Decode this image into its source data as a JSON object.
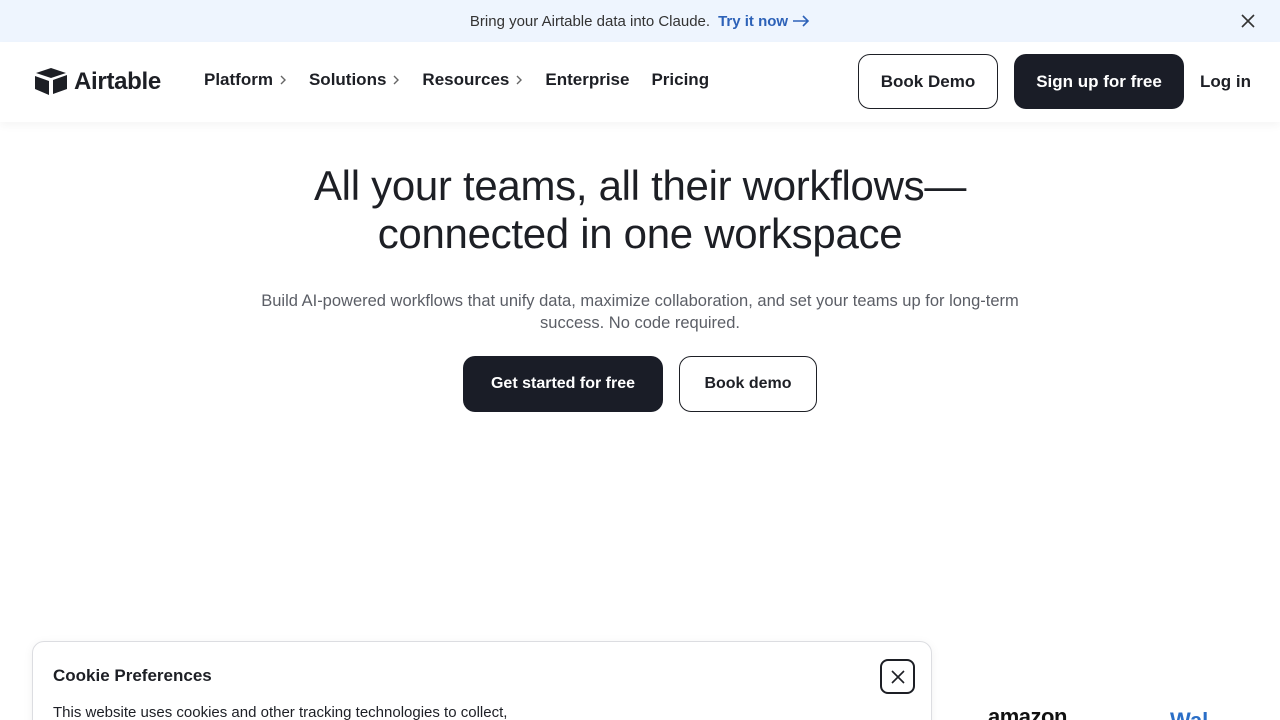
{
  "banner": {
    "message": "Bring your Airtable data into Claude.",
    "link_label": "Try it now",
    "link_icon": "arrow-right-icon",
    "close_icon": "close-icon"
  },
  "header": {
    "logo_text": "Airtable",
    "nav": [
      {
        "label": "Platform",
        "has_chevron": true
      },
      {
        "label": "Solutions",
        "has_chevron": true
      },
      {
        "label": "Resources",
        "has_chevron": true
      },
      {
        "label": "Enterprise",
        "has_chevron": false
      },
      {
        "label": "Pricing",
        "has_chevron": false
      }
    ],
    "book_demo_label": "Book Demo",
    "signup_label": "Sign up for free",
    "login_label": "Log in"
  },
  "hero": {
    "title_line1": "All your teams, all their workflows—",
    "title_line2": "connected in one workspace",
    "subtitle_line1": "Build AI-powered workflows that unify data, maximize collaboration, and set your teams up for long-term",
    "subtitle_line2": "success. No code required.",
    "primary_cta": "Get started for free",
    "secondary_cta": "Book demo"
  },
  "logos": {
    "amazon": "amazon",
    "walmart": "Wal"
  },
  "cookie": {
    "title": "Cookie Preferences",
    "text": "This website uses cookies and other tracking technologies to collect,",
    "close_icon": "close-icon"
  },
  "colors": {
    "banner_bg": "#eef5fe",
    "link_blue": "#2d62b8",
    "dark_button": "#1a1d27",
    "text": "#1d1f25"
  }
}
